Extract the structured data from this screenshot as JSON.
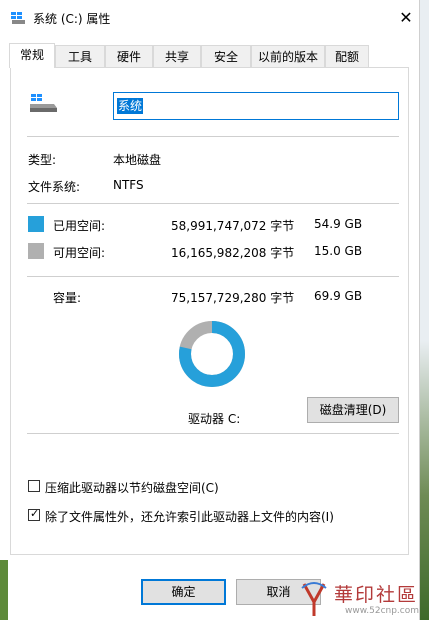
{
  "window": {
    "title": "系统 (C:) 属性",
    "close_label": "✕"
  },
  "tabs": [
    "常规",
    "工具",
    "硬件",
    "共享",
    "安全",
    "以前的版本",
    "配额"
  ],
  "general": {
    "drive_name": "系统",
    "type_label": "类型:",
    "type_value": "本地磁盘",
    "fs_label": "文件系统:",
    "fs_value": "NTFS",
    "used": {
      "label": "已用空间:",
      "bytes": "58,991,747,072 字节",
      "size": "54.9 GB",
      "color": "#26a0da"
    },
    "free": {
      "label": "可用空间:",
      "bytes": "16,165,982,208 字节",
      "size": "15.0 GB",
      "color": "#b0b0b0"
    },
    "capacity": {
      "label": "容量:",
      "bytes": "75,157,729,280 字节",
      "size": "69.9 GB"
    },
    "used_fraction": 0.785,
    "drive_label": "驱动器 C:",
    "cleanup_button": "磁盘清理(D)",
    "compress_label": "压缩此驱动器以节约磁盘空间(C)",
    "compress_checked": false,
    "index_label": "除了文件属性外，还允许索引此驱动器上文件的内容(I)",
    "index_checked": true
  },
  "buttons": {
    "ok": "确定",
    "cancel": "取消"
  },
  "watermark": {
    "text": "華印社區",
    "url": "www.52cnp.com"
  }
}
